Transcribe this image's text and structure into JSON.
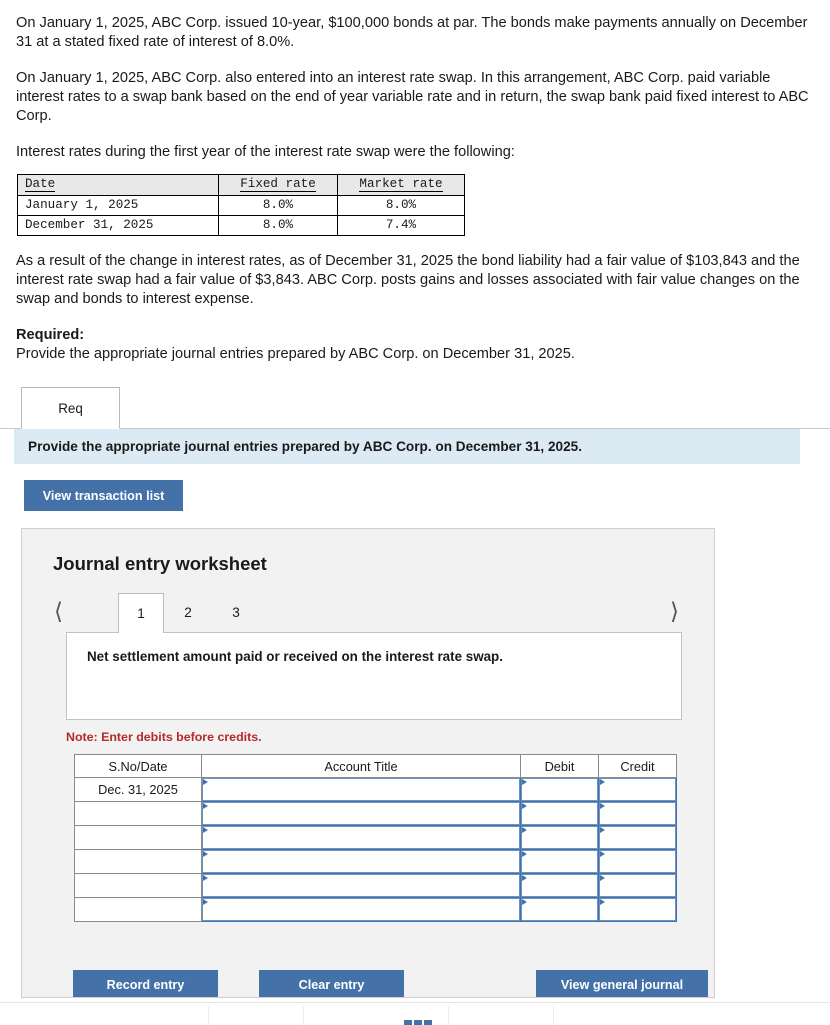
{
  "problem": {
    "paragraph_1": "On January 1, 2025, ABC Corp. issued 10-year, $100,000 bonds at par.  The bonds make payments annually on December 31 at a stated fixed rate of interest of 8.0%.",
    "paragraph_2": "On January 1, 2025, ABC Corp. also entered into an interest rate swap.  In this arrangement, ABC Corp. paid variable interest rates to a swap bank based on the end of year variable rate and in return, the swap bank paid fixed interest to ABC Corp.",
    "paragraph_3": "Interest rates during the first year of the interest rate swap were the following:",
    "paragraph_4": "As a result of the change in interest rates, as of December 31, 2025 the bond liability had a fair value of $103,843 and the interest rate swap had a fair value of $3,843.  ABC Corp. posts gains and losses associated with fair value changes on the swap and bonds to interest expense.",
    "required_label": "Required:",
    "required_text": "Provide the appropriate journal entries prepared by ABC Corp. on December 31, 2025."
  },
  "rate_table": {
    "headers": [
      "Date",
      "Fixed rate",
      "Market rate"
    ],
    "rows": [
      [
        "January 1, 2025",
        "8.0%",
        "8.0%"
      ],
      [
        "December 31, 2025",
        "8.0%",
        "7.4%"
      ]
    ]
  },
  "tabs": {
    "items": [
      {
        "label": "Req",
        "active": true
      }
    ]
  },
  "instruction_bar": {
    "text": "Provide the appropriate journal entries prepared by ABC Corp. on December 31, 2025."
  },
  "buttons": {
    "view_transaction_list": "View transaction list",
    "record_entry": "Record entry",
    "clear_entry": "Clear entry",
    "view_general_journal": "View general journal"
  },
  "worksheet": {
    "title": "Journal entry worksheet",
    "pager": {
      "prev_icon": "chevron-left",
      "next_icon": "chevron-right",
      "pages": [
        "1",
        "2",
        "3"
      ],
      "active_page": "1"
    },
    "description": "Net settlement amount paid or received on the interest rate swap.",
    "note": "Note: Enter debits before credits.",
    "journal_table": {
      "headers": [
        "S.No/Date",
        "Account Title",
        "Debit",
        "Credit"
      ],
      "rows": [
        {
          "date": "Dec. 31, 2025",
          "account": "",
          "debit": "",
          "credit": ""
        },
        {
          "date": "",
          "account": "",
          "debit": "",
          "credit": ""
        },
        {
          "date": "",
          "account": "",
          "debit": "",
          "credit": ""
        },
        {
          "date": "",
          "account": "",
          "debit": "",
          "credit": ""
        },
        {
          "date": "",
          "account": "",
          "debit": "",
          "credit": ""
        },
        {
          "date": "",
          "account": "",
          "debit": "",
          "credit": ""
        }
      ]
    }
  },
  "colors": {
    "accent_blue": "#4472a8",
    "banner_blue": "#dceaf4",
    "note_red": "#b4292c",
    "panel_gray": "#f2f2f2"
  }
}
